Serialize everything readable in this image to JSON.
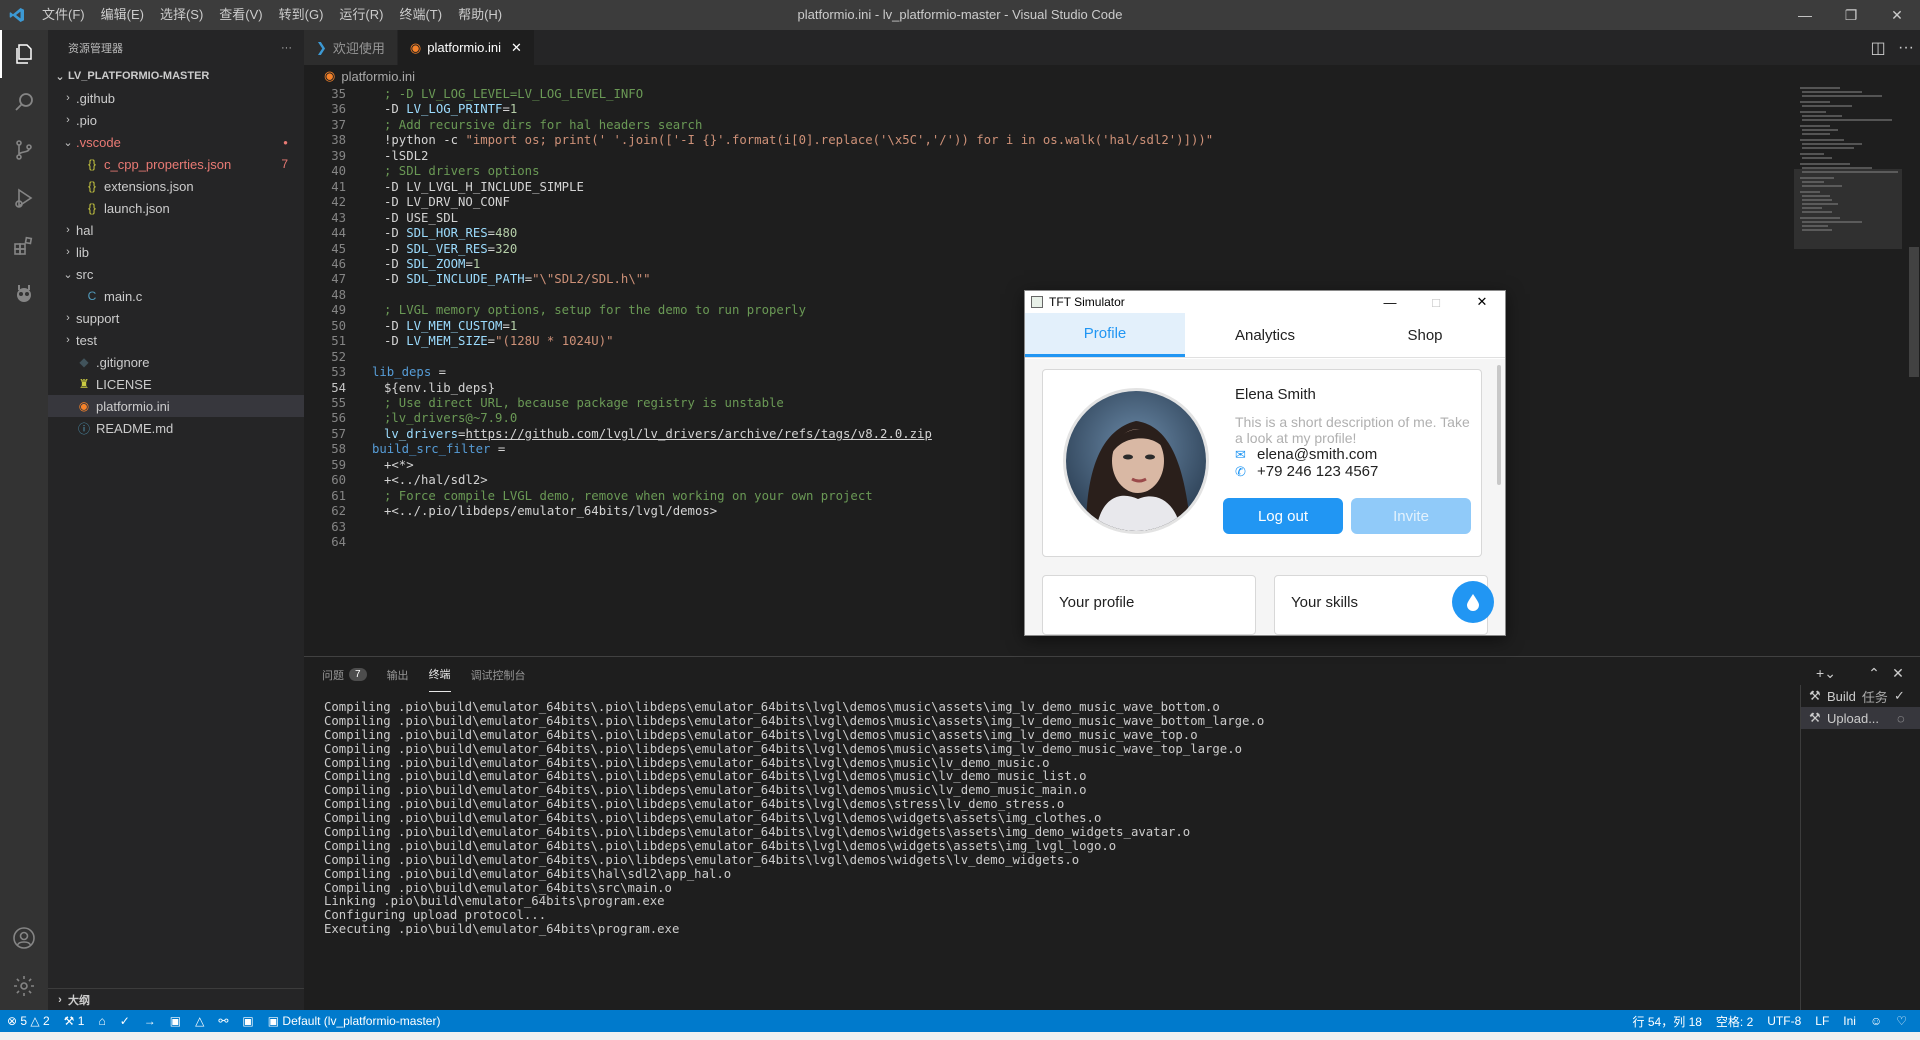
{
  "window": {
    "title": "platformio.ini - lv_platformio-master - Visual Studio Code",
    "menu": [
      "文件(F)",
      "编辑(E)",
      "选择(S)",
      "查看(V)",
      "转到(G)",
      "运行(R)",
      "终端(T)",
      "帮助(H)"
    ]
  },
  "sidebar": {
    "header": "资源管理器",
    "more": "···",
    "root": "LV_PLATFORMIO-MASTER",
    "items": [
      {
        "label": ".github",
        "chevron": "›",
        "icon": ""
      },
      {
        "label": ".pio",
        "chevron": "›",
        "icon": ""
      },
      {
        "label": ".vscode",
        "chevron": "⌄",
        "icon": ""
      },
      {
        "label": "c_cpp_properties.json",
        "chevron": "",
        "icon": "{}",
        "badge": "7"
      },
      {
        "label": "extensions.json",
        "chevron": "",
        "icon": "{}"
      },
      {
        "label": "launch.json",
        "chevron": "",
        "icon": "{}"
      },
      {
        "label": "hal",
        "chevron": "›",
        "icon": ""
      },
      {
        "label": "lib",
        "chevron": "›",
        "icon": ""
      },
      {
        "label": "src",
        "chevron": "⌄",
        "icon": ""
      },
      {
        "label": "main.c",
        "chevron": "",
        "icon": "C"
      },
      {
        "label": "support",
        "chevron": "›",
        "icon": ""
      },
      {
        "label": "test",
        "chevron": "›",
        "icon": ""
      },
      {
        "label": ".gitignore",
        "chevron": "",
        "icon": "◆"
      },
      {
        "label": "LICENSE",
        "chevron": "",
        "icon": "♜"
      },
      {
        "label": "platformio.ini",
        "chevron": "",
        "icon": "◉"
      },
      {
        "label": "README.md",
        "chevron": "",
        "icon": "ⓘ"
      }
    ],
    "outline": "大纲"
  },
  "tabs": [
    {
      "label": "欢迎使用"
    },
    {
      "label": "platformio.ini",
      "close": "✕"
    }
  ],
  "breadcrumb": "platformio.ini",
  "editor": {
    "current_line": 54,
    "lines": [
      {
        "n": "35",
        "html": "<span class='c'>; -D LV_LOG_LEVEL=LV_LOG_LEVEL_INFO</span>",
        "indent": 1
      },
      {
        "n": "36",
        "html": "-D <span class='v'>LV_LOG_PRINTF</span>=<span class='n'>1</span>",
        "indent": 1
      },
      {
        "n": "37",
        "html": "<span class='c'>; Add recursive dirs for hal headers search</span>",
        "indent": 1
      },
      {
        "n": "38",
        "html": "!python -c <span class='s'>\"import os; print(' '.join(['-I {}'.format(i[0].replace('\\x5C','/')) for i in os.walk('hal/sdl2')]))\"</span>",
        "indent": 1
      },
      {
        "n": "39",
        "html": "-lSDL2",
        "indent": 1
      },
      {
        "n": "40",
        "html": "<span class='c'>; SDL drivers options</span>",
        "indent": 1
      },
      {
        "n": "41",
        "html": "-D LV_LVGL_H_INCLUDE_SIMPLE",
        "indent": 1
      },
      {
        "n": "42",
        "html": "-D LV_DRV_NO_CONF",
        "indent": 1
      },
      {
        "n": "43",
        "html": "-D USE_SDL",
        "indent": 1
      },
      {
        "n": "44",
        "html": "-D <span class='v'>SDL_HOR_RES</span>=<span class='n'>480</span>",
        "indent": 1
      },
      {
        "n": "45",
        "html": "-D <span class='v'>SDL_VER_RES</span>=<span class='n'>320</span>",
        "indent": 1
      },
      {
        "n": "46",
        "html": "-D <span class='v'>SDL_ZOOM</span>=<span class='n'>1</span>",
        "indent": 1
      },
      {
        "n": "47",
        "html": "-D <span class='v'>SDL_INCLUDE_PATH</span>=<span class='s'>\"\\\"SDL2/SDL.h\\\"\"</span>",
        "indent": 1
      },
      {
        "n": "48",
        "html": "",
        "indent": 1
      },
      {
        "n": "49",
        "html": "<span class='c'>; LVGL memory options, setup for the demo to run properly</span>",
        "indent": 1
      },
      {
        "n": "50",
        "html": "-D <span class='v'>LV_MEM_CUSTOM</span>=<span class='n'>1</span>",
        "indent": 1
      },
      {
        "n": "51",
        "html": "-D <span class='v'>LV_MEM_SIZE</span>=<span class='s'>\"(128U * 1024U)\"</span>",
        "indent": 1
      },
      {
        "n": "52",
        "html": "",
        "indent": 0
      },
      {
        "n": "53",
        "html": "<span class='k'>lib_deps</span> =",
        "indent": 0
      },
      {
        "n": "54",
        "html": "${env.lib_deps}",
        "indent": 1
      },
      {
        "n": "55",
        "html": "<span class='c'>; Use direct URL, because package registry is unstable</span>",
        "indent": 1
      },
      {
        "n": "56",
        "html": "<span class='c'>;lv_drivers@~7.9.0</span>",
        "indent": 1
      },
      {
        "n": "57",
        "html": "<span class='v'>lv_drivers</span>=<span class='u'>https://github.com/lvgl/lv_drivers/archive/refs/tags/v8.2.0.zip</span>",
        "indent": 1
      },
      {
        "n": "58",
        "html": "<span class='k'>build_src_filter</span> =",
        "indent": 0
      },
      {
        "n": "59",
        "html": "+&lt;*&gt;",
        "indent": 1
      },
      {
        "n": "60",
        "html": "+&lt;../hal/sdl2&gt;",
        "indent": 1
      },
      {
        "n": "61",
        "html": "<span class='c'>; Force compile LVGL demo, remove when working on your own project</span>",
        "indent": 1
      },
      {
        "n": "62",
        "html": "+&lt;../.pio/libdeps/emulator_64bits/lvgl/demos&gt;",
        "indent": 1
      },
      {
        "n": "63",
        "html": "",
        "indent": 0
      },
      {
        "n": "64",
        "html": "",
        "indent": 0
      }
    ]
  },
  "panel": {
    "tabs": [
      "问题",
      "输出",
      "终端",
      "调试控制台"
    ],
    "problems_count": "7",
    "active_tab": "终端",
    "terminal_lines": [
      "Compiling .pio\\build\\emulator_64bits\\.pio\\libdeps\\emulator_64bits\\lvgl\\demos\\music\\assets\\img_lv_demo_music_wave_bottom.o",
      "Compiling .pio\\build\\emulator_64bits\\.pio\\libdeps\\emulator_64bits\\lvgl\\demos\\music\\assets\\img_lv_demo_music_wave_bottom_large.o",
      "Compiling .pio\\build\\emulator_64bits\\.pio\\libdeps\\emulator_64bits\\lvgl\\demos\\music\\assets\\img_lv_demo_music_wave_top.o",
      "Compiling .pio\\build\\emulator_64bits\\.pio\\libdeps\\emulator_64bits\\lvgl\\demos\\music\\assets\\img_lv_demo_music_wave_top_large.o",
      "Compiling .pio\\build\\emulator_64bits\\.pio\\libdeps\\emulator_64bits\\lvgl\\demos\\music\\lv_demo_music.o",
      "Compiling .pio\\build\\emulator_64bits\\.pio\\libdeps\\emulator_64bits\\lvgl\\demos\\music\\lv_demo_music_list.o",
      "Compiling .pio\\build\\emulator_64bits\\.pio\\libdeps\\emulator_64bits\\lvgl\\demos\\music\\lv_demo_music_main.o",
      "Compiling .pio\\build\\emulator_64bits\\.pio\\libdeps\\emulator_64bits\\lvgl\\demos\\stress\\lv_demo_stress.o",
      "Compiling .pio\\build\\emulator_64bits\\.pio\\libdeps\\emulator_64bits\\lvgl\\demos\\widgets\\assets\\img_clothes.o",
      "Compiling .pio\\build\\emulator_64bits\\.pio\\libdeps\\emulator_64bits\\lvgl\\demos\\widgets\\assets\\img_demo_widgets_avatar.o",
      "Compiling .pio\\build\\emulator_64bits\\.pio\\libdeps\\emulator_64bits\\lvgl\\demos\\widgets\\assets\\img_lvgl_logo.o",
      "Compiling .pio\\build\\emulator_64bits\\.pio\\libdeps\\emulator_64bits\\lvgl\\demos\\widgets\\lv_demo_widgets.o",
      "Compiling .pio\\build\\emulator_64bits\\hal\\sdl2\\app_hal.o",
      "Compiling .pio\\build\\emulator_64bits\\src\\main.o",
      "Linking .pio\\build\\emulator_64bits\\program.exe",
      "Configuring upload protocol...",
      "Executing .pio\\build\\emulator_64bits\\program.exe"
    ],
    "tasks": [
      {
        "label": "Build",
        "suffix": "任务",
        "state": "✓"
      },
      {
        "label": "Upload...",
        "suffix": "",
        "state": "◌"
      }
    ]
  },
  "statusbar": {
    "errors": "5",
    "warnings": "2",
    "remote": "1",
    "env": "Default (lv_platformio-master)",
    "position": "行 54，列 18",
    "spaces": "空格: 2",
    "encoding": "UTF-8",
    "eol": "LF",
    "language": "Ini"
  },
  "tft": {
    "title": "TFT Simulator",
    "tabs": [
      "Profile",
      "Analytics",
      "Shop"
    ],
    "name": "Elena Smith",
    "description": "This is a short description of me. Take a look at my profile!",
    "email": "elena@smith.com",
    "phone": "+79 246 123 4567",
    "logout": "Log out",
    "invite": "Invite",
    "card_profile": "Your profile",
    "card_skills": "Your skills"
  },
  "colors": {
    "accent": "#007acc",
    "lvgl_primary": "#2196f3"
  }
}
